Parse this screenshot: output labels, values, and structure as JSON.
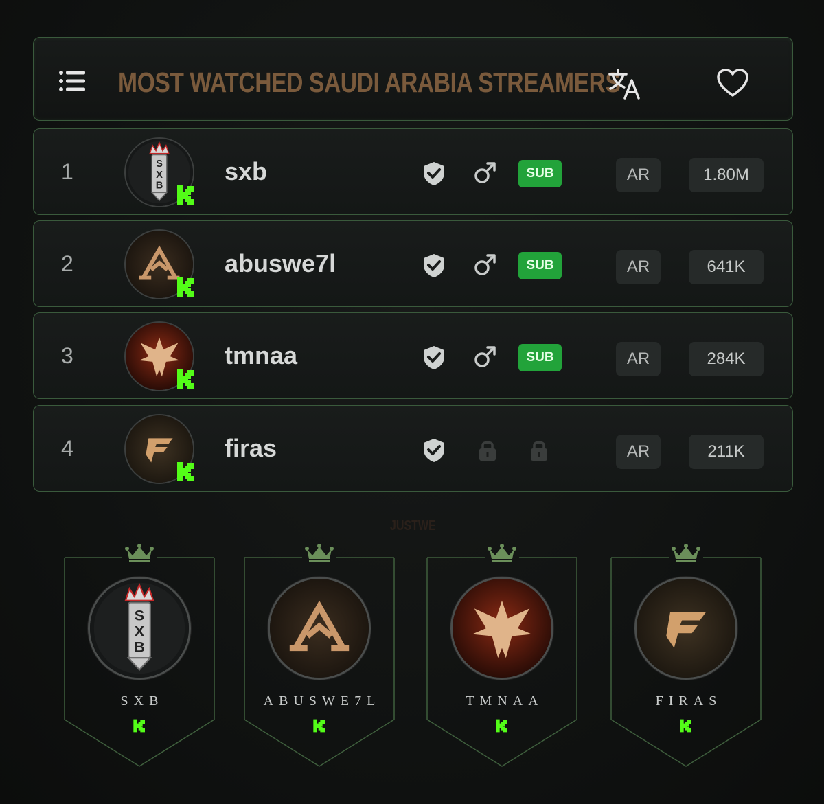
{
  "header": {
    "title": "MOST WATCHED SAUDI ARABIA STREAMERS",
    "icons": [
      "menu-icon",
      "translate-icon",
      "heart-icon"
    ]
  },
  "colors": {
    "accent_green": "#22a33a",
    "kick_green": "#53fc18",
    "title_brown": "#7a5a3c",
    "border_green": "#3a5a3c"
  },
  "streamers": [
    {
      "rank": "1",
      "name": "sxb",
      "verified": true,
      "gender": "male",
      "sub": "SUB",
      "lang": "AR",
      "views": "1.80M",
      "avatar_theme": "crown-sword"
    },
    {
      "rank": "2",
      "name": "abuswe7l",
      "verified": true,
      "gender": "male",
      "sub": "SUB",
      "lang": "AR",
      "views": "641K",
      "avatar_theme": "gold-a"
    },
    {
      "rank": "3",
      "name": "tmnaa",
      "verified": true,
      "gender": "male",
      "sub": "SUB",
      "lang": "AR",
      "views": "284K",
      "avatar_theme": "red-dragon"
    },
    {
      "rank": "4",
      "name": "firas",
      "verified": true,
      "gender": "locked",
      "sub": "locked",
      "lang": "AR",
      "views": "211K",
      "avatar_theme": "gold-f"
    }
  ],
  "watermark": "JUSTWE",
  "banners": [
    {
      "name": "SXB"
    },
    {
      "name": "ABUSWE7L"
    },
    {
      "name": "TMNAA"
    },
    {
      "name": "FIRAS"
    }
  ]
}
